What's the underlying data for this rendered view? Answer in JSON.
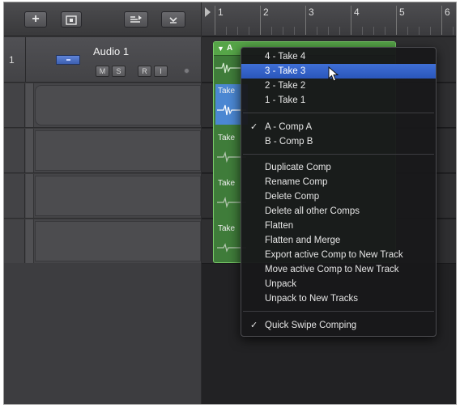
{
  "toolbar": {
    "add_label": "+",
    "buttons": [
      "add-track",
      "add-folder",
      "catch-playhead",
      "track-options"
    ]
  },
  "track": {
    "number": "1",
    "name": "Audio 1",
    "mute": "M",
    "solo": "S",
    "record": "R",
    "input": "I"
  },
  "ruler": {
    "bars": [
      "1",
      "2",
      "3",
      "4",
      "5",
      "6"
    ]
  },
  "region": {
    "letter": "A",
    "takes": [
      "Take",
      "Take",
      "Take",
      "Take"
    ]
  },
  "menu": {
    "takes": [
      "4 - Take 4",
      "3 - Take 3",
      "2 - Take 2",
      "1 - Take 1"
    ],
    "highlighted": "3 - Take 3",
    "comps": [
      "A - Comp A",
      "B - Comp B"
    ],
    "checked_comp": "A - Comp A",
    "actions": [
      "Duplicate Comp",
      "Rename Comp",
      "Delete Comp",
      "Delete all other Comps",
      "Flatten",
      "Flatten and Merge",
      "Export active Comp to New Track",
      "Move active Comp to New Track",
      "Unpack",
      "Unpack to New Tracks"
    ],
    "quick_swipe": "Quick Swipe Comping",
    "check_mark": "✓"
  },
  "colors": {
    "region_green": "#56a548",
    "menu_highlight": "#2a56bb"
  }
}
